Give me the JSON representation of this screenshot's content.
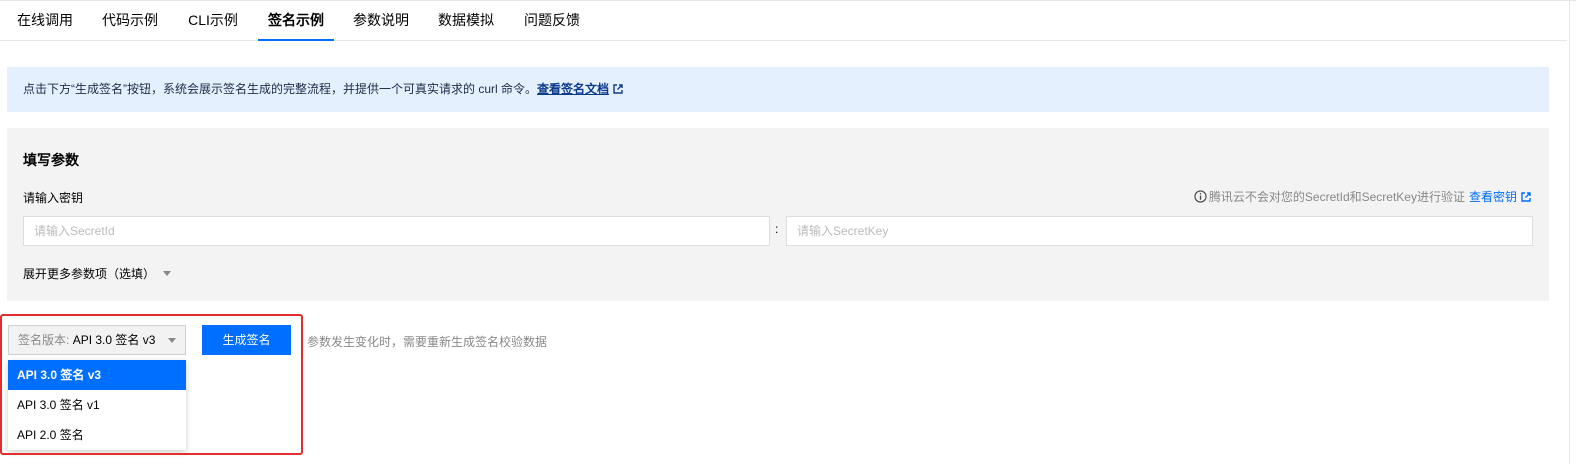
{
  "tabs": [
    {
      "label": "在线调用"
    },
    {
      "label": "代码示例"
    },
    {
      "label": "CLI示例"
    },
    {
      "label": "签名示例",
      "active": true
    },
    {
      "label": "参数说明"
    },
    {
      "label": "数据模拟"
    },
    {
      "label": "问题反馈"
    }
  ],
  "notice": {
    "text": "点击下方“生成签名”按钮，系统会展示签名生成的完整流程，并提供一个可真实请求的 curl 命令。",
    "link_label": "查看签名文档"
  },
  "params": {
    "title": "填写参数",
    "secret_label": "请输入密钥",
    "hint_text": "腾讯云不会对您的SecretId和SecretKey进行验证",
    "hint_link": "查看密钥",
    "secret_id_placeholder": "请输入SecretId",
    "secret_key_placeholder": "请输入SecretKey",
    "separator": ":",
    "expand_label": "展开更多参数项（选填）"
  },
  "signature": {
    "version_prefix": "签名版本:",
    "version_selected": "API 3.0 签名 v3",
    "generate_button": "生成签名",
    "tip": "参数发生变化时，需要重新生成签名校验数据",
    "options": [
      "API 3.0 签名 v3",
      "API 3.0 签名 v1",
      "API 2.0 签名"
    ]
  },
  "colors": {
    "accent": "#006eff",
    "notice_bg": "#e5f0ff",
    "panel_bg": "#f3f3f3",
    "highlight": "#e22e2e"
  },
  "icons": [
    "external-link-icon",
    "info-icon",
    "chevron-down-icon"
  ]
}
